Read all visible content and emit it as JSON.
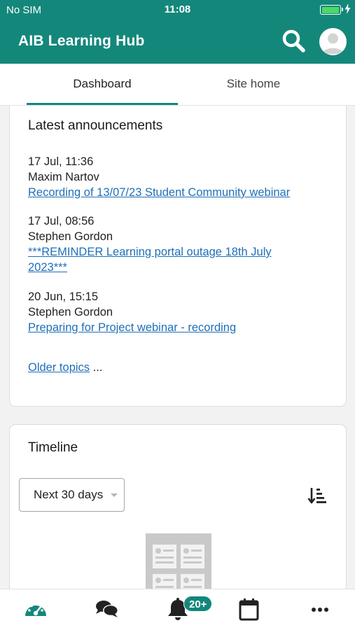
{
  "status_bar": {
    "carrier": "No SIM",
    "time": "11:08",
    "battery_level": 1.0
  },
  "header": {
    "title": "AIB Learning Hub",
    "search_icon": "search-icon",
    "avatar_icon": "user-avatar-icon"
  },
  "tabs": [
    {
      "label": "Dashboard",
      "selected": true
    },
    {
      "label": "Site home",
      "selected": false
    }
  ],
  "announcements": {
    "title": "Latest announcements",
    "items": [
      {
        "date": "17 Jul, 11:36",
        "author": "Maxim Nartov",
        "link": "Recording of 13/07/23 Student Community webinar"
      },
      {
        "date": "17 Jul, 08:56",
        "author": "Stephen Gordon",
        "link": "***REMINDER Learning portal outage 18th July 2023***"
      },
      {
        "date": "20 Jun, 15:15",
        "author": "Stephen Gordon",
        "link": "Preparing for Project webinar - recording"
      }
    ],
    "older_link": "Older topics",
    "older_suffix": " ..."
  },
  "timeline": {
    "title": "Timeline",
    "filter_value": "Next 30 days",
    "sort_icon": "sort-icon"
  },
  "bottom_nav": {
    "items": [
      "dashboard-icon",
      "messages-icon",
      "notifications-icon",
      "calendar-icon",
      "more-icon"
    ],
    "notification_badge": "20+"
  },
  "colors": {
    "brand": "#14877b",
    "link": "#1f6fb8"
  }
}
